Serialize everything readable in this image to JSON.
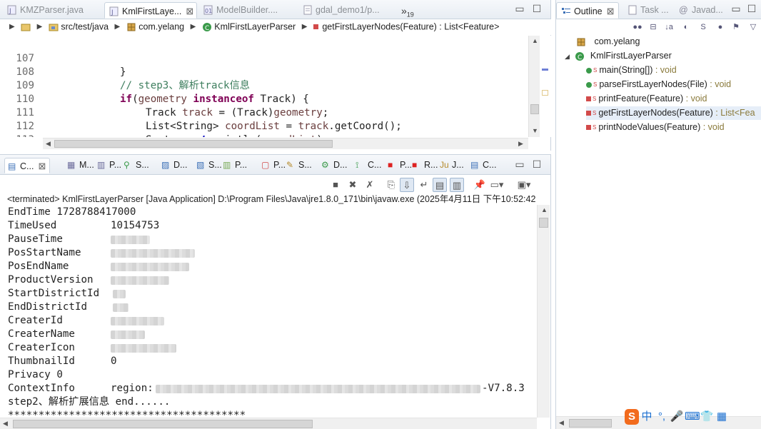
{
  "editor": {
    "tabs": [
      {
        "label": "KMZParser.java",
        "active": false
      },
      {
        "label": "KmlFirstLaye...",
        "active": true
      },
      {
        "label": "ModelBuilder....",
        "active": false
      },
      {
        "label": "gdal_demo1/p...",
        "active": false
      }
    ],
    "overflow_count": "19",
    "overflow_label": "»",
    "breadcrumb": [
      "src/test/java",
      "com.yelang",
      "KmlFirstLayerParser",
      "getFirstLayerNodes(Feature) : List<Feature>"
    ],
    "lines": [
      {
        "num": "107",
        "text": "}"
      },
      {
        "num": "108",
        "text": "// step3、解析track信息"
      },
      {
        "num": "109",
        "text": "if(geometry instanceof Track) {"
      },
      {
        "num": "110",
        "text": "Track track = (Track)geometry;"
      },
      {
        "num": "111",
        "text": "List<String> coordList = track.getCoord();"
      },
      {
        "num": "112",
        "text": "System.out.println(coordList);"
      },
      {
        "num": "113",
        "text": "List<Data> dataList = track.getExtendedData().getData();"
      }
    ]
  },
  "console": {
    "tabs": [
      "C...",
      "M...",
      "P...",
      "S...",
      "D...",
      "S...",
      "P...",
      "P...",
      "S...",
      "D...",
      "C...",
      "P...",
      "R...",
      "J...",
      "C..."
    ],
    "terminated": "<terminated> KmlFirstLayerParser [Java Application] D:\\Program Files\\Java\\jre1.8.0_171\\bin\\javaw.exe (2025年4月11日 下午10:52:42",
    "output": [
      {
        "key": "EndTime 1728788417000",
        "value": ""
      },
      {
        "key": "TimeUsed",
        "value": "10154753"
      },
      {
        "key": "PauseTime",
        "value": ""
      },
      {
        "key": "PosStartName",
        "value": ""
      },
      {
        "key": "PosEndName",
        "value": ""
      },
      {
        "key": "ProductVersion",
        "value": ""
      },
      {
        "key": "StartDistrictId",
        "value": ""
      },
      {
        "key": "EndDistrictId",
        "value": ""
      },
      {
        "key": "CreaterId",
        "value": ""
      },
      {
        "key": "CreaterName",
        "value": ""
      },
      {
        "key": "CreaterIcon",
        "value": ""
      },
      {
        "key": "ThumbnailId",
        "value": "0"
      },
      {
        "key": "Privacy 0",
        "value": ""
      },
      {
        "key": "ContextInfo",
        "value": "region:"
      },
      {
        "key": "step2、解析扩展信息 end......",
        "value": ""
      },
      {
        "key": "***************************************",
        "value": ""
      }
    ],
    "context_suffix": "V7.8.3"
  },
  "outline": {
    "tabs": [
      "Outline",
      "Task ...",
      "Javad..."
    ],
    "package": "com.yelang",
    "class_name": "KmlFirstLayerParser",
    "methods": [
      {
        "name": "main(String[])",
        "ret": " : void",
        "visibility": "public",
        "selected": false
      },
      {
        "name": "parseFirstLayerNodes(File)",
        "ret": " : void",
        "visibility": "public",
        "selected": false
      },
      {
        "name": "printFeature(Feature)",
        "ret": " : void",
        "visibility": "private",
        "selected": false
      },
      {
        "name": "getFirstLayerNodes(Feature)",
        "ret": " : List<Fea",
        "visibility": "private",
        "selected": true
      },
      {
        "name": "printNodeValues(Feature)",
        "ret": " : void",
        "visibility": "private",
        "selected": false
      }
    ],
    "ime": [
      "S",
      "中",
      "°,",
      "🎤",
      "⌨",
      "👕",
      "▦"
    ]
  },
  "colors": {
    "keyword": "#7f0055",
    "comment": "#3f7f5f",
    "field": "#0000c0",
    "variable": "#6a3e3e",
    "selection": "#e6eef8"
  }
}
